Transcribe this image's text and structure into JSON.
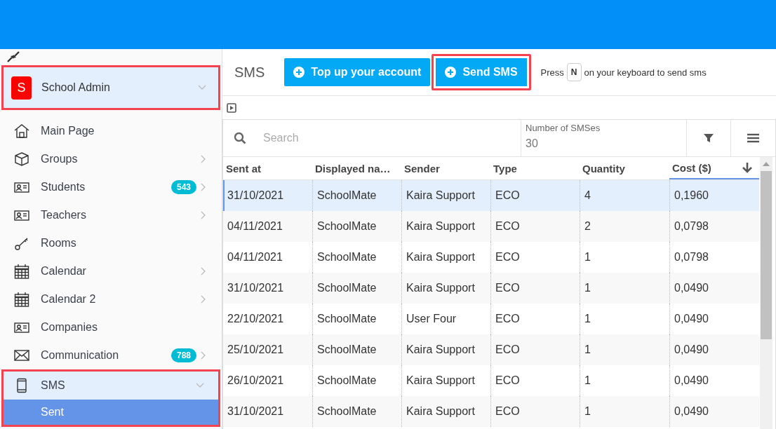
{
  "sidebar": {
    "account": {
      "initial": "S",
      "name": "School Admin",
      "highlighted": true
    },
    "items": [
      {
        "kind": "home",
        "label": "Main Page",
        "expandable": false,
        "selected": false,
        "highlighted": false
      },
      {
        "kind": "box",
        "label": "Groups",
        "expandable": true,
        "selected": false,
        "highlighted": false
      },
      {
        "kind": "card",
        "label": "Students",
        "badge": "543",
        "expandable": true,
        "selected": false,
        "highlighted": false
      },
      {
        "kind": "card",
        "label": "Teachers",
        "expandable": true,
        "selected": false,
        "highlighted": false
      },
      {
        "kind": "key",
        "label": "Rooms",
        "expandable": false,
        "selected": false,
        "highlighted": false
      },
      {
        "kind": "calendar",
        "label": "Calendar",
        "expandable": true,
        "selected": false,
        "highlighted": false
      },
      {
        "kind": "calendar",
        "label": "Calendar 2",
        "expandable": true,
        "selected": false,
        "highlighted": false
      },
      {
        "kind": "card",
        "label": "Companies",
        "expandable": false,
        "selected": false,
        "highlighted": false
      },
      {
        "kind": "mail",
        "label": "Communication",
        "badge": "788",
        "expandable": true,
        "selected": false,
        "highlighted": false
      },
      {
        "kind": "phone",
        "label": "SMS",
        "expandable": true,
        "selected": true,
        "highlighted": true,
        "children": [
          {
            "label": "Sent",
            "selected": true
          }
        ]
      }
    ]
  },
  "header": {
    "title": "SMS",
    "buttons": [
      {
        "label": "Top up your account",
        "highlighted": false
      },
      {
        "label": "Send SMS",
        "highlighted": true
      }
    ],
    "hint": {
      "before": "Press",
      "key": "N",
      "after": "on your keyboard to send sms"
    }
  },
  "table": {
    "search": {
      "placeholder": "Search"
    },
    "page_size": {
      "label": "Number of SMSes",
      "value": "30"
    },
    "columns": [
      {
        "label": "Sent at",
        "sorted": false
      },
      {
        "label": "Displayed na…",
        "sorted": false
      },
      {
        "label": "Sender",
        "sorted": false
      },
      {
        "label": "Type",
        "sorted": false
      },
      {
        "label": "Quantity",
        "sorted": false
      },
      {
        "label": "Cost ($)",
        "sorted": true
      }
    ],
    "rows": [
      {
        "cells": [
          "31/10/2021",
          "SchoolMate",
          "Kaira Support",
          "ECO",
          "4",
          "0,1960"
        ],
        "selected": true
      },
      {
        "cells": [
          "04/11/2021",
          "SchoolMate",
          "Kaira Support",
          "ECO",
          "2",
          "0,0798"
        ],
        "selected": false
      },
      {
        "cells": [
          "04/11/2021",
          "SchoolMate",
          "Kaira Support",
          "ECO",
          "1",
          "0,0798"
        ],
        "selected": false
      },
      {
        "cells": [
          "31/10/2021",
          "SchoolMate",
          "Kaira Support",
          "ECO",
          "1",
          "0,0490"
        ],
        "selected": false
      },
      {
        "cells": [
          "22/10/2021",
          "SchoolMate",
          "User Four",
          "ECO",
          "1",
          "0,0490"
        ],
        "selected": false
      },
      {
        "cells": [
          "25/10/2021",
          "SchoolMate",
          "Kaira Support",
          "ECO",
          "1",
          "0,0490"
        ],
        "selected": false
      },
      {
        "cells": [
          "26/10/2021",
          "SchoolMate",
          "Kaira Support",
          "ECO",
          "1",
          "0,0490"
        ],
        "selected": false
      },
      {
        "cells": [
          "31/10/2021",
          "SchoolMate",
          "Kaira Support",
          "ECO",
          "1",
          "0,0490"
        ],
        "selected": false
      }
    ]
  }
}
